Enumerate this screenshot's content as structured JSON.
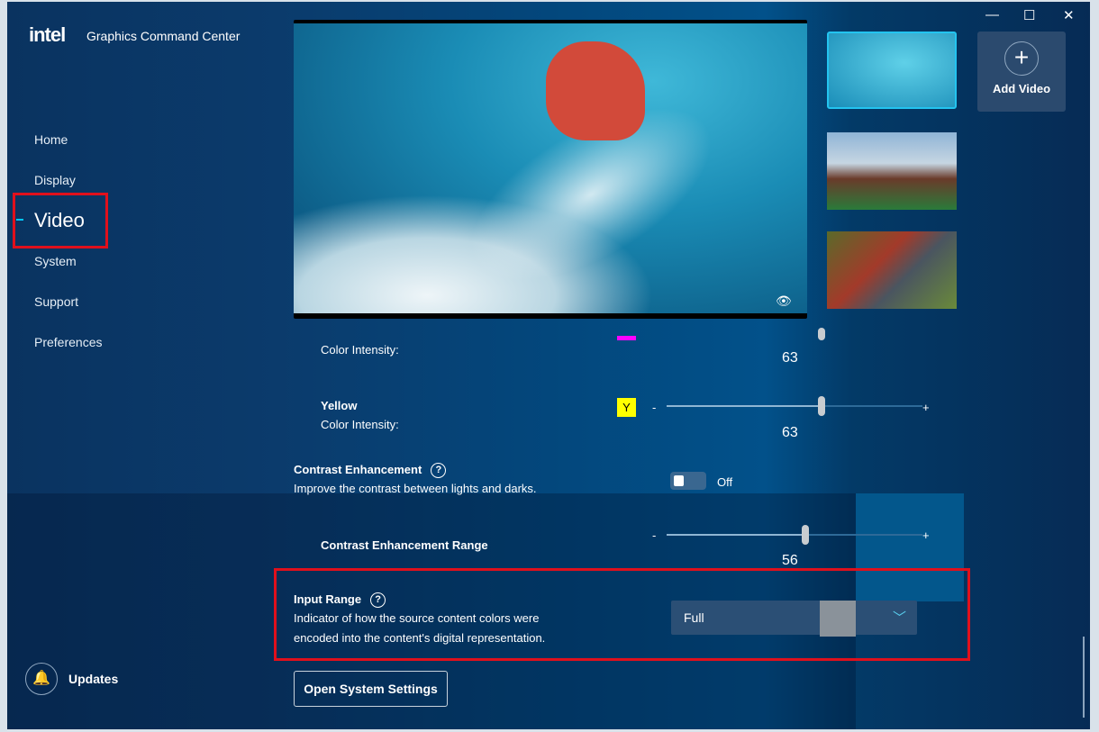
{
  "app": {
    "logo": "intel",
    "title": "Graphics Command Center"
  },
  "window_controls": {
    "minimize": "—",
    "maximize": "☐",
    "close": "✕"
  },
  "nav": [
    {
      "label": "Home"
    },
    {
      "label": "Display"
    },
    {
      "label": "Video"
    },
    {
      "label": "System"
    },
    {
      "label": "Support"
    },
    {
      "label": "Preferences"
    }
  ],
  "active_nav": "Video",
  "add_video": {
    "label": "Add Video",
    "icon": "+"
  },
  "settings": {
    "magenta": {
      "sublabel": "Color Intensity:",
      "value": "63",
      "swatch": "#ff00ff",
      "slider_value": 63
    },
    "yellow": {
      "label": "Yellow",
      "sublabel": "Color Intensity:",
      "badge": "Y",
      "value": "63",
      "minus": "-",
      "plus": "+",
      "swatch": "#ffff00",
      "slider_value": 63
    },
    "contrast": {
      "label": "Contrast Enhancement",
      "help": "?",
      "description": "Improve the contrast between lights and darks.",
      "state": "Off"
    },
    "contrast_range": {
      "label": "Contrast Enhancement Range",
      "value": "56",
      "minus": "-",
      "plus": "+",
      "slider_value": 56
    },
    "input_range": {
      "label": "Input Range",
      "help": "?",
      "description_line1": "Indicator of how the source content colors were",
      "description_line2": "encoded into the content's digital representation.",
      "selected": "Full"
    }
  },
  "open_system_settings": "Open System Settings",
  "updates": "Updates"
}
